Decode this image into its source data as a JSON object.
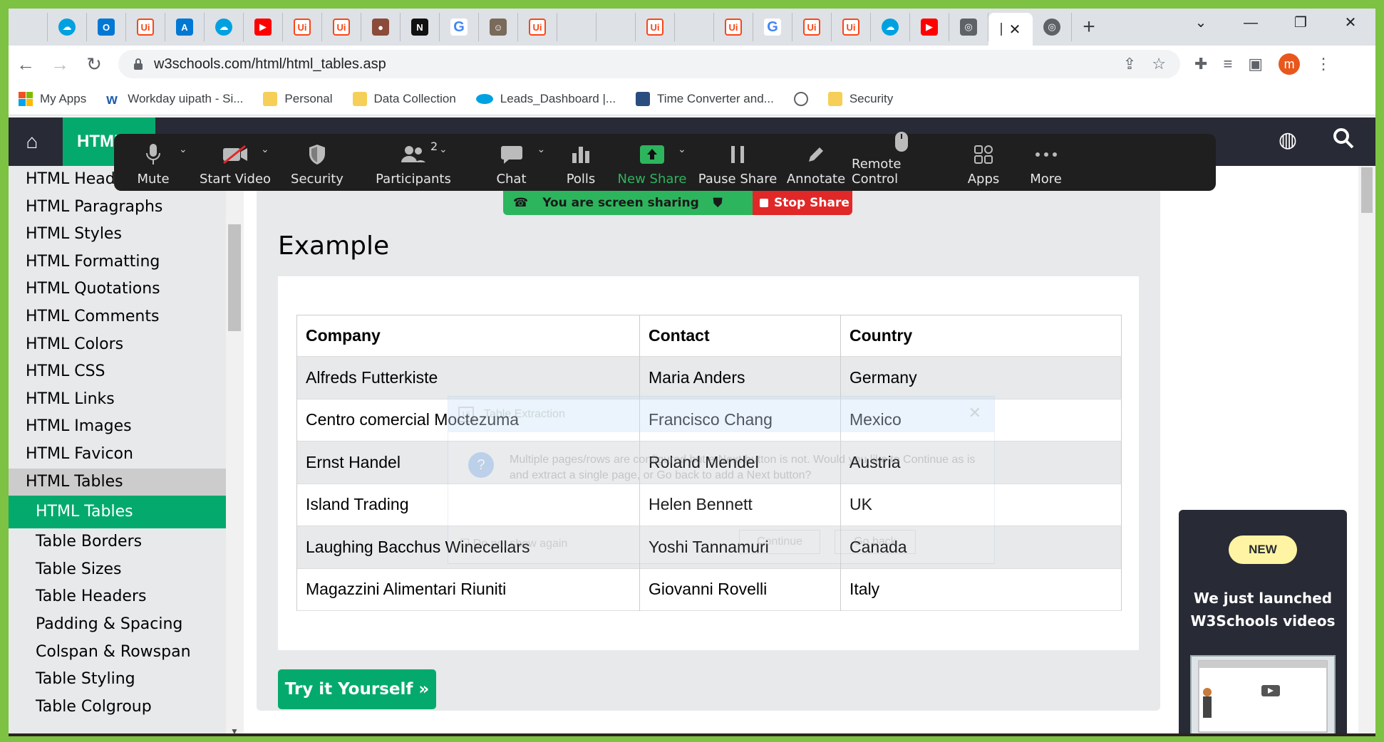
{
  "browser": {
    "tabs": [
      {
        "icon": "microsoft-icon",
        "color": "#f25022"
      },
      {
        "icon": "salesforce-icon",
        "color": "#00a1e0"
      },
      {
        "icon": "outlook-icon",
        "color": "#0078d4"
      },
      {
        "icon": "uipath-icon",
        "color": "#fa4616"
      },
      {
        "icon": "azure-icon",
        "color": "#0078d4"
      },
      {
        "icon": "salesforce-icon",
        "color": "#00a1e0"
      },
      {
        "icon": "youtube-icon",
        "color": "#ff0000"
      },
      {
        "icon": "uipath-icon",
        "color": "#fa4616"
      },
      {
        "icon": "uipath-icon",
        "color": "#fa4616"
      },
      {
        "icon": "profile-icon",
        "color": "#8b4a3a"
      },
      {
        "icon": "notion-icon",
        "color": "#111111"
      },
      {
        "icon": "google-icon",
        "color": "#4285f4"
      },
      {
        "icon": "avatar-icon",
        "color": "#7a6a5a"
      },
      {
        "icon": "uipath-icon",
        "color": "#fa4616"
      },
      {
        "icon": "microsoft-icon",
        "color": "#f25022"
      },
      {
        "icon": "microsoft-icon",
        "color": "#f25022"
      },
      {
        "icon": "uipath-icon",
        "color": "#fa4616"
      },
      {
        "icon": "microsoft-icon",
        "color": "#f25022"
      },
      {
        "icon": "uipath-icon",
        "color": "#fa4616"
      },
      {
        "icon": "google-icon",
        "color": "#4285f4"
      },
      {
        "icon": "uipath-icon",
        "color": "#fa4616"
      },
      {
        "icon": "uipath-icon",
        "color": "#fa4616"
      },
      {
        "icon": "salesforce-icon",
        "color": "#00a1e0"
      },
      {
        "icon": "youtube-icon",
        "color": "#ff0000"
      },
      {
        "icon": "globe-icon",
        "color": "#5f6368"
      }
    ],
    "url": "w3schools.com/html/html_tables.asp",
    "profile_initial": "m"
  },
  "bookmarks": [
    {
      "label": "My Apps",
      "icon": "microsoft-icon",
      "color": "#f25022"
    },
    {
      "label": "Workday uipath - Si...",
      "icon": "workday-icon",
      "color": "#f3a312"
    },
    {
      "label": "Personal",
      "icon": "folder-icon",
      "color": "#f5cf58"
    },
    {
      "label": "Data Collection",
      "icon": "folder-icon",
      "color": "#f5cf58"
    },
    {
      "label": "Leads_Dashboard |...",
      "icon": "salesforce-icon",
      "color": "#00a1e0"
    },
    {
      "label": "Time Converter and...",
      "icon": "clock-icon",
      "color": "#2b4c7e"
    },
    {
      "label": "",
      "icon": "globe-icon",
      "color": "#5f6368"
    },
    {
      "label": "Security",
      "icon": "folder-icon",
      "color": "#f5cf58"
    }
  ],
  "w3nav": {
    "section": "HTML"
  },
  "zoom": {
    "buttons": [
      {
        "label": "Mute",
        "icon": "microphone-icon",
        "caret": true
      },
      {
        "label": "Start Video",
        "icon": "video-off-icon",
        "caret": true
      },
      {
        "label": "Security",
        "icon": "shield-icon",
        "caret": false
      },
      {
        "label": "Participants",
        "icon": "participants-icon",
        "caret": true,
        "badge": "2"
      },
      {
        "label": "Chat",
        "icon": "chat-icon",
        "caret": true
      },
      {
        "label": "Polls",
        "icon": "polls-icon",
        "caret": false
      },
      {
        "label": "New Share",
        "icon": "share-icon",
        "caret": true,
        "highlight": true
      },
      {
        "label": "Pause Share",
        "icon": "pause-icon",
        "caret": false
      },
      {
        "label": "Annotate",
        "icon": "pencil-icon",
        "caret": false
      },
      {
        "label": "Remote Control",
        "icon": "mouse-icon",
        "caret": false
      },
      {
        "label": "Apps",
        "icon": "apps-icon",
        "caret": false
      },
      {
        "label": "More",
        "icon": "more-icon",
        "caret": false
      }
    ],
    "sharing_text": "You are screen sharing",
    "stop_share": "Stop Share",
    "accent": "#2db55d",
    "stop_color": "#e02828"
  },
  "sidebar": {
    "items": [
      {
        "label": "HTML Headings",
        "type": "item"
      },
      {
        "label": "HTML Paragraphs",
        "type": "item"
      },
      {
        "label": "HTML Styles",
        "type": "item"
      },
      {
        "label": "HTML Formatting",
        "type": "item"
      },
      {
        "label": "HTML Quotations",
        "type": "item"
      },
      {
        "label": "HTML Comments",
        "type": "item"
      },
      {
        "label": "HTML Colors",
        "type": "item"
      },
      {
        "label": "HTML CSS",
        "type": "item"
      },
      {
        "label": "HTML Links",
        "type": "item"
      },
      {
        "label": "HTML Images",
        "type": "item"
      },
      {
        "label": "HTML Favicon",
        "type": "item"
      },
      {
        "label": "HTML Tables",
        "type": "group"
      },
      {
        "label": "HTML Tables",
        "type": "active"
      },
      {
        "label": "Table Borders",
        "type": "sub"
      },
      {
        "label": "Table Sizes",
        "type": "sub"
      },
      {
        "label": "Table Headers",
        "type": "sub"
      },
      {
        "label": "Padding & Spacing",
        "type": "sub"
      },
      {
        "label": "Colspan & Rowspan",
        "type": "sub"
      },
      {
        "label": "Table Styling",
        "type": "sub"
      },
      {
        "label": "Table Colgroup",
        "type": "sub"
      }
    ]
  },
  "example": {
    "heading": "Example",
    "table": {
      "headers": [
        "Company",
        "Contact",
        "Country"
      ],
      "rows": [
        [
          "Alfreds Futterkiste",
          "Maria Anders",
          "Germany"
        ],
        [
          "Centro comercial Moctezuma",
          "Francisco Chang",
          "Mexico"
        ],
        [
          "Ernst Handel",
          "Roland Mendel",
          "Austria"
        ],
        [
          "Island Trading",
          "Helen Bennett",
          "UK"
        ],
        [
          "Laughing Bacchus Winecellars",
          "Yoshi Tannamuri",
          "Canada"
        ],
        [
          "Magazzini Alimentari Riuniti",
          "Giovanni Rovelli",
          "Italy"
        ]
      ]
    },
    "try_button": "Try it Yourself »"
  },
  "dialog": {
    "title": "Table Extraction",
    "message": "Multiple pages/rows are configured but a Next button is not. Would you like to Continue as is and extract a single page, or Go back to add a Next button?",
    "checkbox": "Do not show again",
    "continue": "Continue",
    "go_back": "Go back"
  },
  "ad": {
    "badge": "NEW",
    "text": "We just launched W3Schools videos"
  }
}
